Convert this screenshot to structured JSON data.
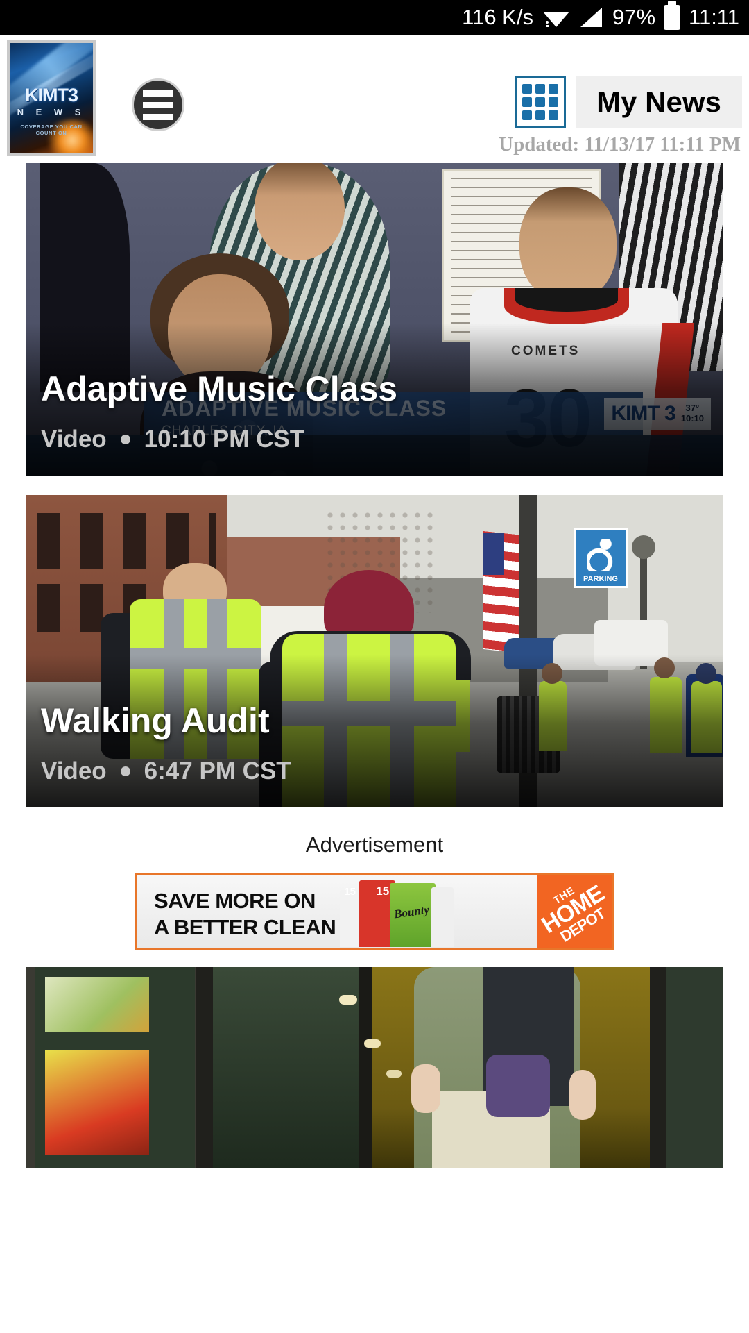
{
  "status_bar": {
    "network_speed": "116 K/s",
    "battery_percent": "97%",
    "clock": "11:11",
    "icons": [
      "wifi-icon",
      "cellular-signal-icon",
      "battery-icon"
    ]
  },
  "header": {
    "logo": {
      "station": "KIMT3",
      "subtitle": "N E W S",
      "tagline": "COVERAGE YOU CAN COUNT ON"
    },
    "menu_icon": "hamburger-menu-icon",
    "grid_icon": "grid-view-icon",
    "my_news_label": "My News",
    "updated_label": "Updated: 11/13/17 11:11 PM"
  },
  "feed": {
    "cards": [
      {
        "title": "Adaptive Music Class",
        "media_type": "Video",
        "timestamp": "10:10 PM CST",
        "lower_third_title": "ADAPTIVE MUSIC CLASS",
        "lower_third_location": "CHARLES CITY, IA",
        "bug_station": "KIMT 3",
        "bug_temp": "37°",
        "bug_time": "10:10",
        "jersey_team": "COMETS",
        "jersey_number": "30"
      },
      {
        "title": "Walking Audit",
        "media_type": "Video",
        "timestamp": "6:47 PM CST",
        "sign_label": "PARKING"
      },
      {
        "title": "",
        "media_type": "",
        "timestamp": ""
      }
    ]
  },
  "advertisement": {
    "label": "Advertisement",
    "headline_line1": "SAVE MORE ON",
    "headline_line2": "A BETTER CLEAN",
    "product_badge_1": "15",
    "product_badge_2": "15",
    "product_brand": "Bounty",
    "brand_line1": "THE",
    "brand_line2": "HOME",
    "brand_line3": "DEPOT"
  },
  "colors": {
    "accent_blue": "#1a6fa8",
    "ad_orange": "#f26522",
    "status_bar_bg": "#000000",
    "vest_green": "#ccf442"
  }
}
